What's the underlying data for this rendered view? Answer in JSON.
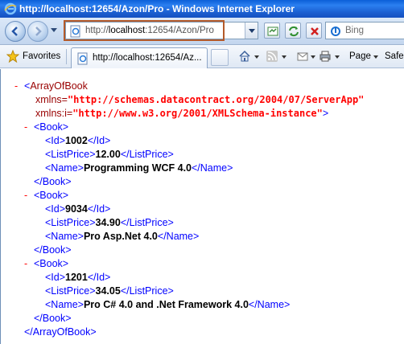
{
  "window": {
    "title": "http://localhost:12654/Azon/Pro - Windows Internet Explorer"
  },
  "address_bar": {
    "url_prefix": "http://",
    "url_host": "localhost",
    "url_rest": ":12654/Azon/Pro"
  },
  "search": {
    "placeholder": "Bing"
  },
  "command_bar": {
    "favorites_label": "Favorites",
    "tab_label": "http://localhost:12654/Az...",
    "page_label": "Page",
    "safety_label": "Safe"
  },
  "xml": {
    "minus": "-",
    "root_open": "<",
    "root_name": "ArrayOfBook",
    "xmlns_attr": "xmlns=",
    "xmlns_value": "\"http://schemas.datacontract.org/2004/07/ServerApp\"",
    "xmlns_i_attr": "xmlns:i=",
    "xmlns_i_value": "\"http://www.w3.org/2001/XMLSchema-instance\"",
    "root_open_close": ">",
    "root_close_text": "</ArrayOfBook>",
    "book_open": "<Book>",
    "book_close": "</Book>",
    "id_open": "<Id>",
    "id_close": "</Id>",
    "price_open": "<ListPrice>",
    "price_close": "</ListPrice>",
    "name_open": "<Name>",
    "name_close": "</Name>",
    "books": [
      {
        "id": "1002",
        "price": "12.00",
        "name": "Programming WCF 4.0"
      },
      {
        "id": "9034",
        "price": "34.90",
        "name": "Pro Asp.Net 4.0"
      },
      {
        "id": "1201",
        "price": "34.05",
        "name": "Pro C# 4.0 and .Net Framework 4.0"
      }
    ]
  }
}
